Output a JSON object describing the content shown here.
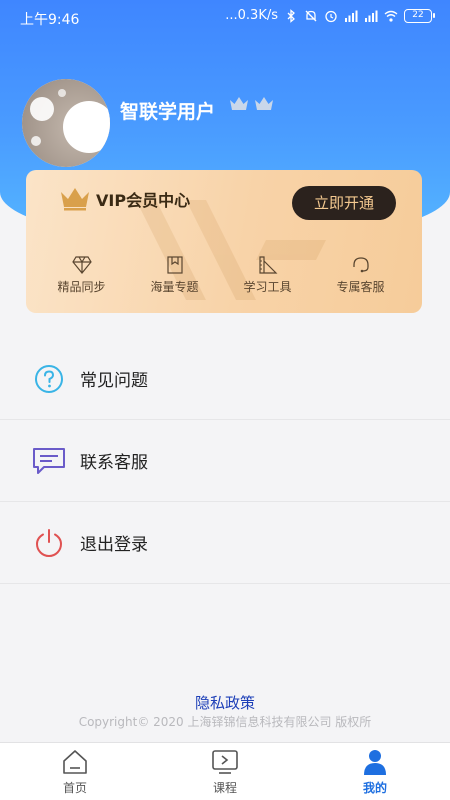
{
  "status_bar": {
    "time": "上午9:46",
    "network": "...0.3K/s",
    "battery": "22"
  },
  "profile": {
    "username": "智联学用户"
  },
  "vip_card": {
    "title": "VIP会员中心",
    "open_button": "立即开通",
    "features": [
      {
        "label": "精品同步",
        "icon": "diamond-icon"
      },
      {
        "label": "海量专题",
        "icon": "bookmark-icon"
      },
      {
        "label": "学习工具",
        "icon": "ruler-icon"
      },
      {
        "label": "专属客服",
        "icon": "headset-icon"
      }
    ]
  },
  "menu": {
    "items": [
      {
        "label": "常见问题",
        "icon": "question-icon",
        "color": "#39b4e6"
      },
      {
        "label": "联系客服",
        "icon": "message-icon",
        "color": "#6a5bc9"
      },
      {
        "label": "退出登录",
        "icon": "power-icon",
        "color": "#e05252"
      }
    ]
  },
  "footer": {
    "privacy": "隐私政策",
    "copyright": "Copyright© 2020 上海铎锦信息科技有限公司 版权所"
  },
  "bottom_nav": {
    "items": [
      {
        "label": "首页",
        "icon": "home-icon",
        "active": false
      },
      {
        "label": "课程",
        "icon": "course-icon",
        "active": false
      },
      {
        "label": "我的",
        "icon": "user-icon",
        "active": true
      }
    ],
    "active_color": "#1e6fe0"
  },
  "colors": {
    "header_blue": "#3f86ff",
    "vip_gold": "#f8d3a8",
    "vip_button": "#2b221d"
  }
}
